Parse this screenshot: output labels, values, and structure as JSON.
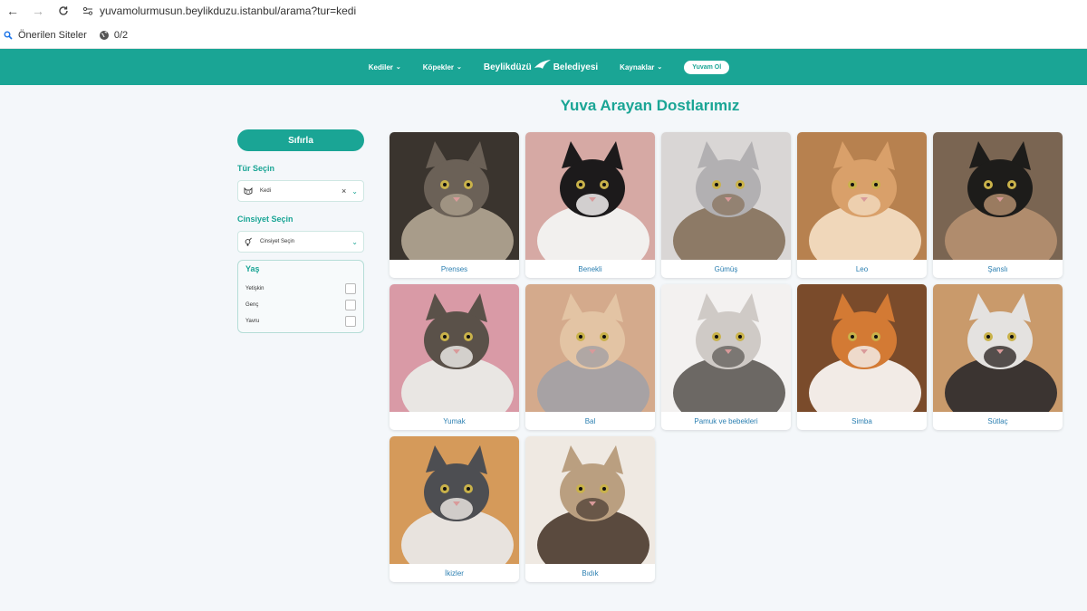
{
  "browser": {
    "url": "yuvamolurmusun.beylikduzu.istanbul/arama?tur=kedi",
    "bookmarks": [
      {
        "label": "Önerilen Siteler",
        "icon": "search-icon"
      },
      {
        "label": "0/2",
        "icon": "globe-icon"
      }
    ]
  },
  "nav": {
    "items": [
      {
        "label": "Kediler"
      },
      {
        "label": "Köpekler"
      }
    ],
    "logo_main": "Beylikdüzü",
    "logo_sub": "Belediyesi",
    "right_item": "Kaynaklar",
    "cta": "Yuvam Ol"
  },
  "page": {
    "title": "Yuva Arayan Dostlarımız"
  },
  "sidebar": {
    "reset": "Sıfırla",
    "type_label": "Tür Seçin",
    "type_value": "Kedi",
    "gender_label": "Cinsiyet Seçin",
    "gender_placeholder": "Cinsiyet Seçin",
    "age_label": "Yaş",
    "age_options": [
      "Yetişkin",
      "Genç",
      "Yavru"
    ]
  },
  "pets": [
    {
      "name": "Prenses",
      "colors": [
        "#6b6157",
        "#a89c8a",
        "#3a342e"
      ]
    },
    {
      "name": "Benekli",
      "colors": [
        "#1c1a1b",
        "#f2f0ee",
        "#d6a9a4"
      ]
    },
    {
      "name": "Gümüş",
      "colors": [
        "#b2b0b2",
        "#8d7a66",
        "#d9d6d5"
      ]
    },
    {
      "name": "Leo",
      "colors": [
        "#d9a06a",
        "#f0d7ba",
        "#b7814f"
      ]
    },
    {
      "name": "Şanslı",
      "colors": [
        "#1d1c1a",
        "#b08c6d",
        "#7a6552"
      ]
    },
    {
      "name": "Yumak",
      "colors": [
        "#5a5149",
        "#e9e6e3",
        "#d99aa6"
      ]
    },
    {
      "name": "Bal",
      "colors": [
        "#e3c4a4",
        "#a7a2a4",
        "#d4aa8c"
      ]
    },
    {
      "name": "Pamuk ve bebekleri",
      "colors": [
        "#cfcac6",
        "#6c6864",
        "#f3f1f0"
      ]
    },
    {
      "name": "Simba",
      "colors": [
        "#d37a34",
        "#f2ebe6",
        "#7a4b2b"
      ]
    },
    {
      "name": "Sütlaç",
      "colors": [
        "#e4e2e0",
        "#3b3431",
        "#c99a6b"
      ]
    },
    {
      "name": "İkizler",
      "colors": [
        "#4d4e52",
        "#e8e3de",
        "#d59a5a"
      ]
    },
    {
      "name": "Bıdık",
      "colors": [
        "#ba9f80",
        "#5a4a3e",
        "#efe9e2"
      ]
    }
  ]
}
